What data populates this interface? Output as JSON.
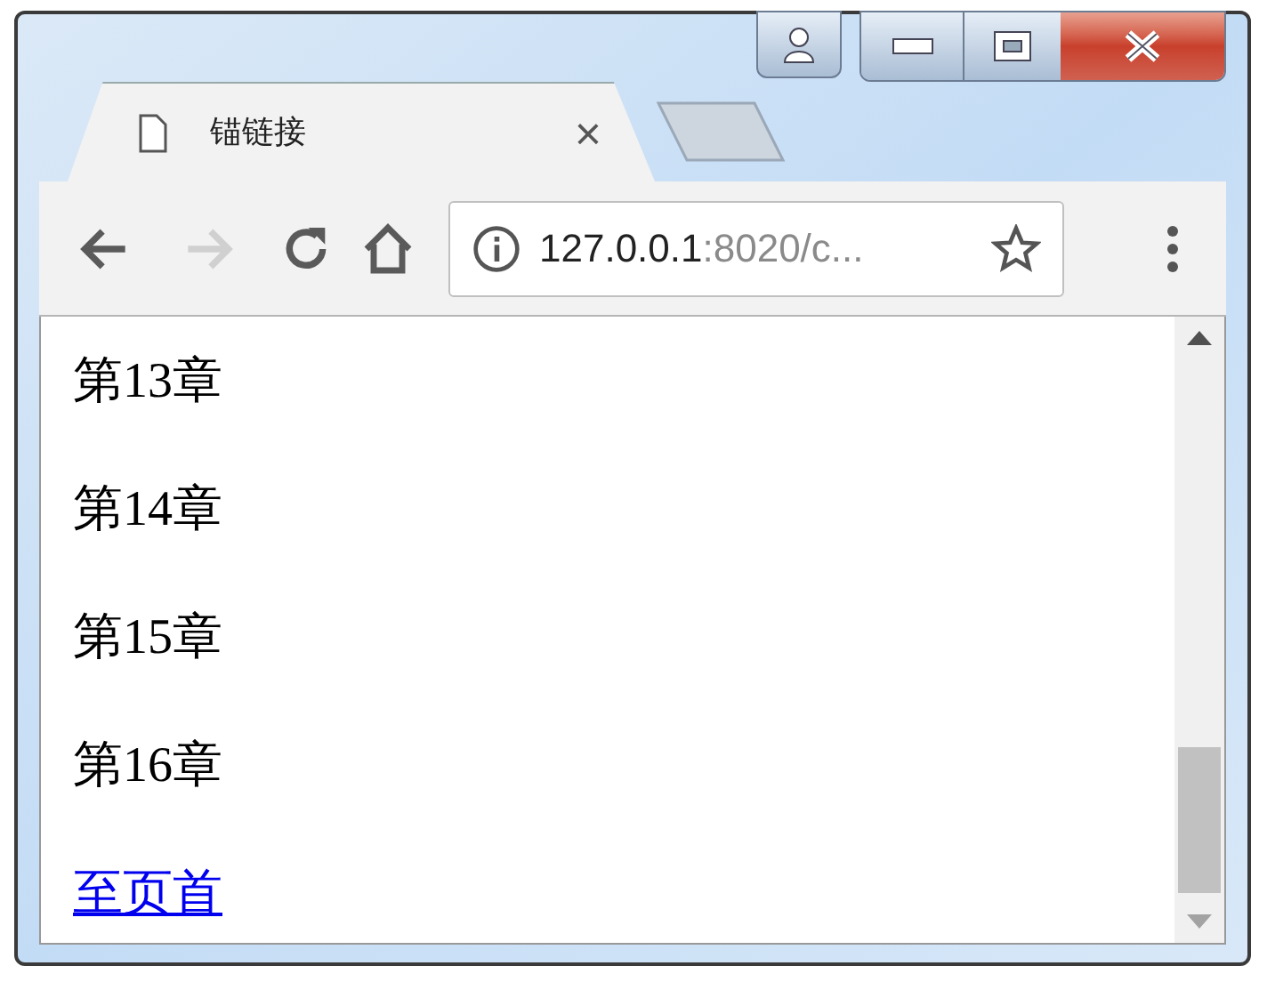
{
  "tab": {
    "title": "锚链接",
    "close": "×",
    "selected": true
  },
  "toolbar": {
    "back": {
      "disabled": false
    },
    "forward": {
      "disabled": true
    }
  },
  "address": {
    "host": "127.0.0.1",
    "rest": ":8020/c..."
  },
  "content": {
    "paragraphs": [
      "第13章",
      "第14章",
      "第15章",
      "第16章"
    ],
    "link": "至页首"
  }
}
